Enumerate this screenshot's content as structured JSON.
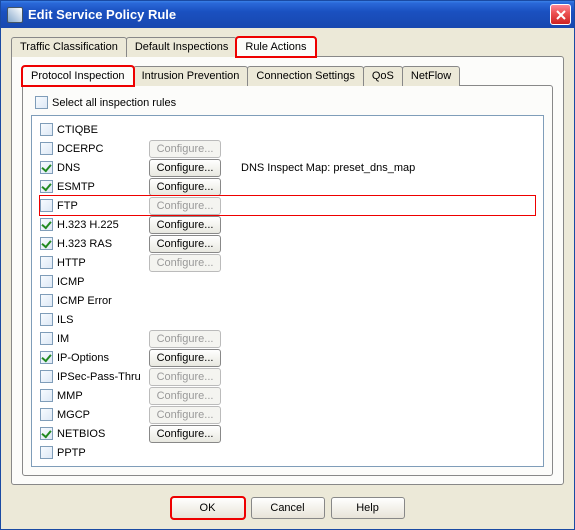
{
  "window": {
    "title": "Edit Service Policy Rule"
  },
  "main_tabs": [
    {
      "label": "Traffic Classification",
      "active": false,
      "hl": false
    },
    {
      "label": "Default Inspections",
      "active": false,
      "hl": false
    },
    {
      "label": "Rule Actions",
      "active": true,
      "hl": true
    }
  ],
  "sub_tabs": [
    {
      "label": "Protocol Inspection",
      "active": true,
      "hl": true
    },
    {
      "label": "Intrusion Prevention",
      "active": false,
      "hl": false
    },
    {
      "label": "Connection Settings",
      "active": false,
      "hl": false
    },
    {
      "label": "QoS",
      "active": false,
      "hl": false
    },
    {
      "label": "NetFlow",
      "active": false,
      "hl": false
    }
  ],
  "select_all": {
    "label": "Select all inspection rules",
    "checked": false
  },
  "configure_label": "Configure...",
  "rows": [
    {
      "name": "CTIQBE",
      "checked": false,
      "btn": "none",
      "hl": false
    },
    {
      "name": "DCERPC",
      "checked": false,
      "btn": "disabled",
      "hl": false
    },
    {
      "name": "DNS",
      "checked": true,
      "btn": "enabled",
      "info": "DNS Inspect Map: preset_dns_map",
      "hl": false
    },
    {
      "name": "ESMTP",
      "checked": true,
      "btn": "enabled",
      "hl": false
    },
    {
      "name": "FTP",
      "checked": false,
      "btn": "disabled",
      "hl": true
    },
    {
      "name": "H.323 H.225",
      "checked": true,
      "btn": "enabled",
      "hl": false
    },
    {
      "name": "H.323 RAS",
      "checked": true,
      "btn": "enabled",
      "hl": false
    },
    {
      "name": "HTTP",
      "checked": false,
      "btn": "disabled",
      "hl": false
    },
    {
      "name": "ICMP",
      "checked": false,
      "btn": "none",
      "hl": false
    },
    {
      "name": "ICMP Error",
      "checked": false,
      "btn": "none",
      "hl": false
    },
    {
      "name": "ILS",
      "checked": false,
      "btn": "none",
      "hl": false
    },
    {
      "name": "IM",
      "checked": false,
      "btn": "disabled",
      "hl": false
    },
    {
      "name": "IP-Options",
      "checked": true,
      "btn": "enabled",
      "hl": false
    },
    {
      "name": "IPSec-Pass-Thru",
      "checked": false,
      "btn": "disabled",
      "hl": false
    },
    {
      "name": "MMP",
      "checked": false,
      "btn": "disabled",
      "hl": false
    },
    {
      "name": "MGCP",
      "checked": false,
      "btn": "disabled",
      "hl": false
    },
    {
      "name": "NETBIOS",
      "checked": true,
      "btn": "enabled",
      "hl": false
    },
    {
      "name": "PPTP",
      "checked": false,
      "btn": "none",
      "hl": false
    }
  ],
  "footer": {
    "ok": "OK",
    "cancel": "Cancel",
    "help": "Help",
    "ok_hl": true
  }
}
